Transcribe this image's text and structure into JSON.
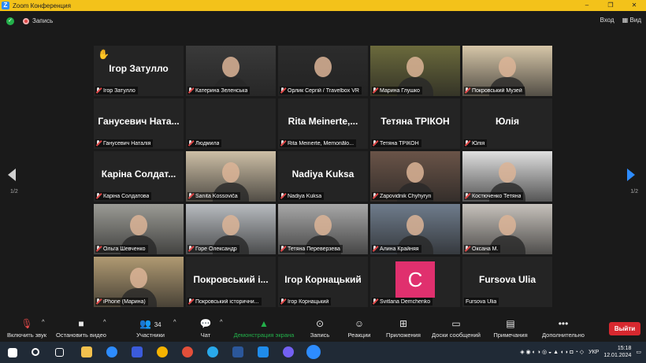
{
  "window": {
    "title": "Zoom Конференция",
    "controls": [
      "–",
      "❐",
      "✕"
    ]
  },
  "infobar": {
    "recording_label": "Запись",
    "enter_label": "Вход",
    "view_label": "Вид"
  },
  "paging": {
    "left": "1/2",
    "right": "1/2"
  },
  "tiles": [
    {
      "name": "Ігор Затулло",
      "big": "Ігор Затулло",
      "video": false,
      "raised_hand": true
    },
    {
      "name": "Катерина Зеленська",
      "big": "",
      "video": true,
      "color": "#3a3a3a"
    },
    {
      "name": "Орлик Сергій / Travelbox VR",
      "big": "",
      "video": true,
      "color": "#2c2c2c",
      "speaking": true
    },
    {
      "name": "Марина Глушко",
      "big": "",
      "video": true,
      "color": "#6b6a3c"
    },
    {
      "name": "Покровський Музей",
      "big": "",
      "video": true,
      "color": "#d6c6a8"
    },
    {
      "name": "Ганусевич Наталія",
      "big": "Ганусевич Ната...",
      "video": false
    },
    {
      "name": "Людмила",
      "big": "",
      "video": false
    },
    {
      "name": "Rita Meinerte, Memoriālo...",
      "big": "Rita Meinerte,...",
      "video": false
    },
    {
      "name": "Тетяна ТРІКОН",
      "big": "Тетяна ТРІКОН",
      "video": false
    },
    {
      "name": "Юлія",
      "big": "Юлія",
      "video": false
    },
    {
      "name": "Каріна Солдатова",
      "big": "Каріна Солдат...",
      "video": false
    },
    {
      "name": "Sanita Kossoviča",
      "big": "",
      "video": true,
      "color": "#cdbfa6"
    },
    {
      "name": "Nadiya Kuksa",
      "big": "Nadiya Kuksa",
      "video": false
    },
    {
      "name": "Zapovidnik Chyhyryn",
      "big": "",
      "video": true,
      "color": "#6a5448"
    },
    {
      "name": "Костюченко Тетяна",
      "big": "",
      "video": true,
      "color": "#dfdfdf"
    },
    {
      "name": "Ольга Шевченко",
      "big": "",
      "video": true,
      "color": "#9b9b95"
    },
    {
      "name": "Горе Олександр",
      "big": "",
      "video": true,
      "color": "#b8bcc0"
    },
    {
      "name": "Тетяна Переверзева",
      "big": "",
      "video": true,
      "color": "#a8a8a8"
    },
    {
      "name": "Алина Крайняя",
      "big": "",
      "video": true,
      "color": "#6f7c8c"
    },
    {
      "name": "Оксана М.",
      "big": "",
      "video": true,
      "color": "#c7c2bc"
    },
    {
      "name": "iPhone (Марина)",
      "big": "",
      "video": true,
      "color": "#b09a72"
    },
    {
      "name": "Покровський історични...",
      "big": "Покровський і...",
      "video": false
    },
    {
      "name": "Ігор Корнацький",
      "big": "Ігор Корнацький",
      "video": false
    },
    {
      "name": "Svitlana Demchenko",
      "big": "",
      "video": false,
      "avatar_letter": "C"
    },
    {
      "name": "Fursova Ulia",
      "big": "Fursova Ulia",
      "video": false,
      "no_mic": true
    }
  ],
  "toolbar": {
    "audio": "Включить звук",
    "video": "Остановить видео",
    "participants": "Участники",
    "participants_count": "34",
    "chat": "Чат",
    "share": "Демонстрация экрана",
    "record": "Запись",
    "reactions": "Реакции",
    "apps": "Приложения",
    "whiteboards": "Доски сообщений",
    "notes": "Примечания",
    "more": "Дополнительно",
    "leave": "Выйти"
  },
  "taskbar": {
    "lang": "УКР",
    "time": "15:18",
    "date": "12.01.2024"
  }
}
